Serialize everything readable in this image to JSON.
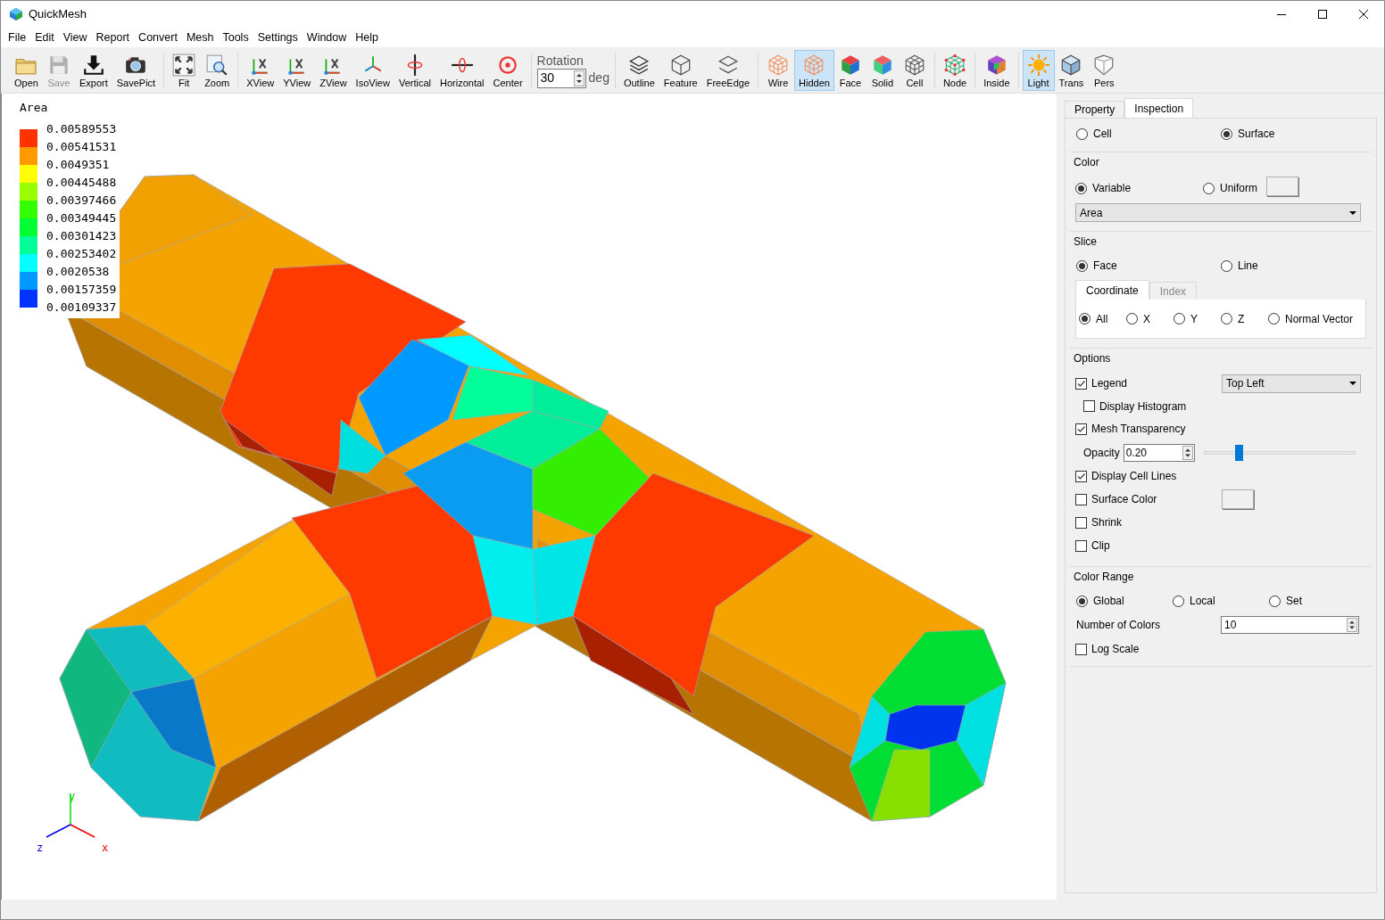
{
  "window": {
    "title": "QuickMesh"
  },
  "menu": [
    "File",
    "Edit",
    "View",
    "Report",
    "Convert",
    "Mesh",
    "Tools",
    "Settings",
    "Window",
    "Help"
  ],
  "toolbar": [
    {
      "kind": "buttons",
      "items": [
        {
          "label": "Open",
          "selected": false,
          "disabled": false
        },
        {
          "label": "Save",
          "selected": false,
          "disabled": true
        },
        {
          "label": "Export",
          "selected": false,
          "disabled": false
        },
        {
          "label": "SavePict",
          "selected": false,
          "disabled": false
        }
      ]
    },
    {
      "kind": "buttons",
      "items": [
        {
          "label": "Fit",
          "selected": false,
          "disabled": false
        },
        {
          "label": "Zoom",
          "selected": false,
          "disabled": false
        }
      ]
    },
    {
      "kind": "buttons",
      "items": [
        {
          "label": "XView",
          "selected": false,
          "disabled": false
        },
        {
          "label": "YView",
          "selected": false,
          "disabled": false
        },
        {
          "label": "ZView",
          "selected": false,
          "disabled": false
        },
        {
          "label": "IsoView",
          "selected": false,
          "disabled": false
        },
        {
          "label": "Vertical",
          "selected": false,
          "disabled": false
        },
        {
          "label": "Horizontal",
          "selected": false,
          "disabled": false
        },
        {
          "label": "Center",
          "selected": false,
          "disabled": false
        }
      ]
    },
    {
      "kind": "rotation",
      "label": "Rotation",
      "value": "30",
      "unit": "deg"
    },
    {
      "kind": "buttons",
      "items": [
        {
          "label": "Outline",
          "selected": false,
          "disabled": false
        },
        {
          "label": "Feature",
          "selected": false,
          "disabled": false
        },
        {
          "label": "FreeEdge",
          "selected": false,
          "disabled": false
        }
      ]
    },
    {
      "kind": "buttons",
      "items": [
        {
          "label": "Wire",
          "selected": false,
          "disabled": false
        },
        {
          "label": "Hidden",
          "selected": true,
          "disabled": false
        },
        {
          "label": "Face",
          "selected": false,
          "disabled": false
        },
        {
          "label": "Solid",
          "selected": false,
          "disabled": false
        },
        {
          "label": "Cell",
          "selected": false,
          "disabled": false
        }
      ]
    },
    {
      "kind": "buttons",
      "items": [
        {
          "label": "Node",
          "selected": false,
          "disabled": false
        }
      ]
    },
    {
      "kind": "buttons",
      "items": [
        {
          "label": "Inside",
          "selected": false,
          "disabled": false
        }
      ]
    },
    {
      "kind": "buttons",
      "items": [
        {
          "label": "Light",
          "selected": true,
          "disabled": false
        },
        {
          "label": "Trans",
          "selected": false,
          "disabled": false
        },
        {
          "label": "Pers",
          "selected": false,
          "disabled": false
        }
      ]
    }
  ],
  "viewport": {
    "legend": {
      "title": "Area",
      "labels": [
        "0.00589553",
        "0.00541531",
        "0.0049351",
        "0.00445488",
        "0.00397466",
        "0.00349445",
        "0.00301423",
        "0.00253402",
        "0.0020538",
        "0.00157359",
        "0.00109337"
      ],
      "bands": [
        {
          "color": "#ff3300"
        },
        {
          "color": "#ff9900"
        },
        {
          "color": "#ffff00"
        },
        {
          "color": "#99ff00"
        },
        {
          "color": "#33ff00"
        },
        {
          "color": "#00ff33"
        },
        {
          "color": "#00ff99"
        },
        {
          "color": "#00ffff"
        },
        {
          "color": "#0099ff"
        },
        {
          "color": "#0033ff"
        }
      ]
    },
    "axes": {
      "x": "x",
      "y": "y",
      "z": "z"
    }
  },
  "panel": {
    "tabs": [
      {
        "label": "Property",
        "selected": false
      },
      {
        "label": "Inspection",
        "selected": true
      }
    ],
    "mode": [
      {
        "label": "Cell",
        "selected": false
      },
      {
        "label": "Surface",
        "selected": true
      }
    ],
    "color": {
      "title": "Color",
      "options": [
        {
          "label": "Variable",
          "selected": true
        },
        {
          "label": "Uniform",
          "selected": false,
          "swatch": true
        }
      ],
      "variable": "Area"
    },
    "slice": {
      "title": "Slice",
      "options": [
        {
          "label": "Face",
          "selected": true
        },
        {
          "label": "Line",
          "selected": false
        }
      ],
      "tabs": [
        {
          "label": "Coordinate",
          "selected": true
        },
        {
          "label": "Index",
          "selected": false
        }
      ],
      "axes": [
        {
          "label": "All",
          "selected": true
        },
        {
          "label": "X",
          "selected": false
        },
        {
          "label": "Y",
          "selected": false
        },
        {
          "label": "Z",
          "selected": false
        },
        {
          "label": "Normal Vector",
          "selected": false
        }
      ]
    },
    "options": {
      "title": "Options",
      "items": [
        {
          "kind": "checkbox",
          "label": "Legend",
          "checked": true,
          "select": "Top Left",
          "children": [
            {
              "label": "Display Histogram",
              "checked": false
            }
          ]
        },
        {
          "kind": "checkbox",
          "label": "Mesh Transparency",
          "checked": true
        },
        {
          "kind": "spin",
          "label": "Opacity",
          "value": "0.20",
          "level": 0.22
        },
        {
          "kind": "checkbox",
          "label": "Display Cell Lines",
          "checked": true
        },
        {
          "kind": "checkbox",
          "label": "Surface Color",
          "checked": false,
          "swatch": true
        },
        {
          "kind": "checkbox",
          "label": "Shrink",
          "checked": false
        },
        {
          "kind": "checkbox",
          "label": "Clip",
          "checked": false
        }
      ]
    },
    "color_range": {
      "title": "Color Range",
      "options": [
        {
          "label": "Global",
          "selected": true
        },
        {
          "label": "Local",
          "selected": false
        },
        {
          "label": "Set",
          "selected": false
        }
      ],
      "colors_label": "Number of Colors",
      "colors_value": "10",
      "log_scale": {
        "label": "Log Scale",
        "checked": false
      }
    }
  }
}
